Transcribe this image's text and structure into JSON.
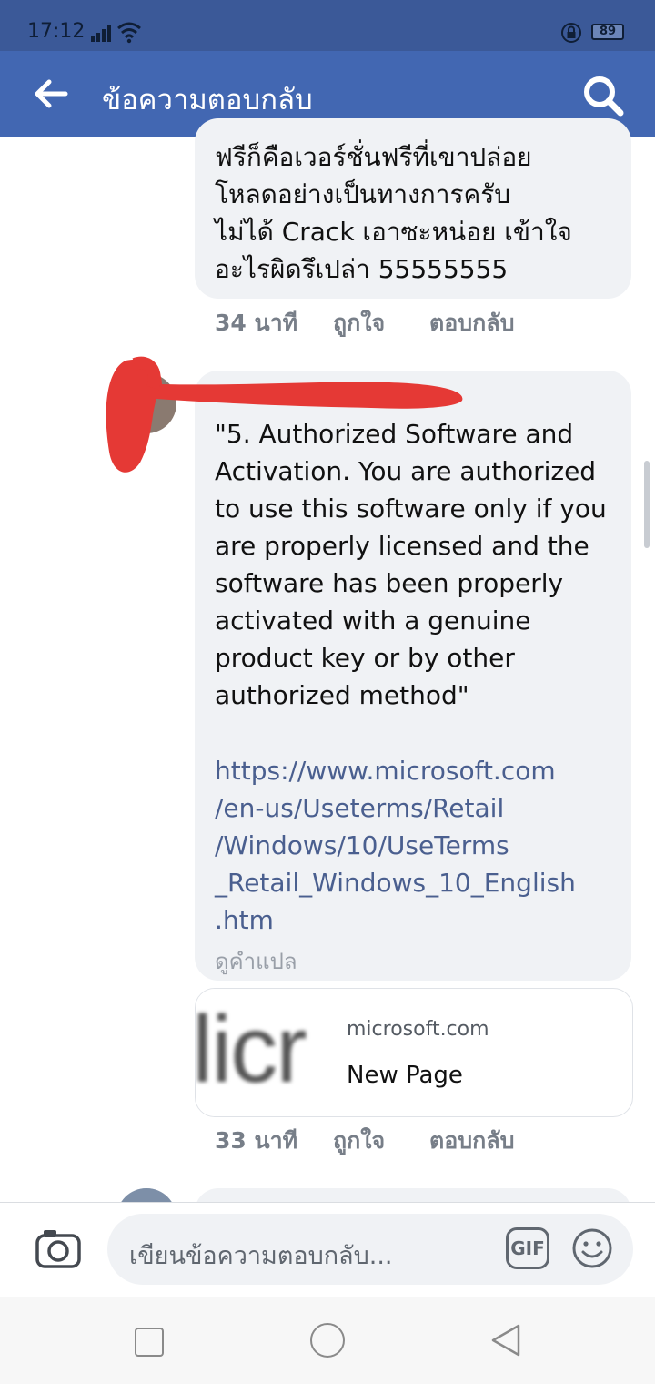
{
  "status": {
    "time": "17:12",
    "battery": "89"
  },
  "header": {
    "title": "ข้อความตอบกลับ"
  },
  "reply1": {
    "text": "ฟรีก็คือเวอร์ชั่นฟรีที่เขาปล่อย\nโหลดอย่างเป็นทางการครับ\nไม่ได้ Crack เอาซะหน่อย เข้าใจ\nอะไรผิดรึเปล่า 55555555",
    "time": "34 นาที",
    "like": "ถูกใจ",
    "reply": "ตอบกลับ"
  },
  "reply2": {
    "text": "\"5. Authorized Software and\nActivation. You are authorized\nto use this software only if you\nare properly licensed and the\nsoftware has been properly\nactivated with a genuine\nproduct key or by other\nauthorized method\"",
    "link": "https://www.microsoft.com\n/en-us/Useterms/Retail\n/Windows/10/UseTerms\n_Retail_Windows_10_English\n.htm",
    "translate": "ดูคำแปล",
    "preview": {
      "thumb_text": "licr",
      "domain": "microsoft.com",
      "title": "New Page"
    },
    "time": "33 นาที",
    "like": "ถูกใจ",
    "reply": "ตอบกลับ"
  },
  "composer": {
    "placeholder": "เขียนข้อความตอบกลับ...",
    "gif": "GIF"
  },
  "colors": {
    "header": "#4267b2",
    "statusbar": "#3b5998",
    "bubble": "#f0f2f5",
    "link": "#4a5f8f",
    "redaction": "#e53935"
  },
  "icons": [
    "back-arrow-icon",
    "search-icon",
    "camera-icon",
    "gif-icon",
    "smiley-icon",
    "wifi-icon",
    "lock-icon",
    "battery-icon"
  ]
}
